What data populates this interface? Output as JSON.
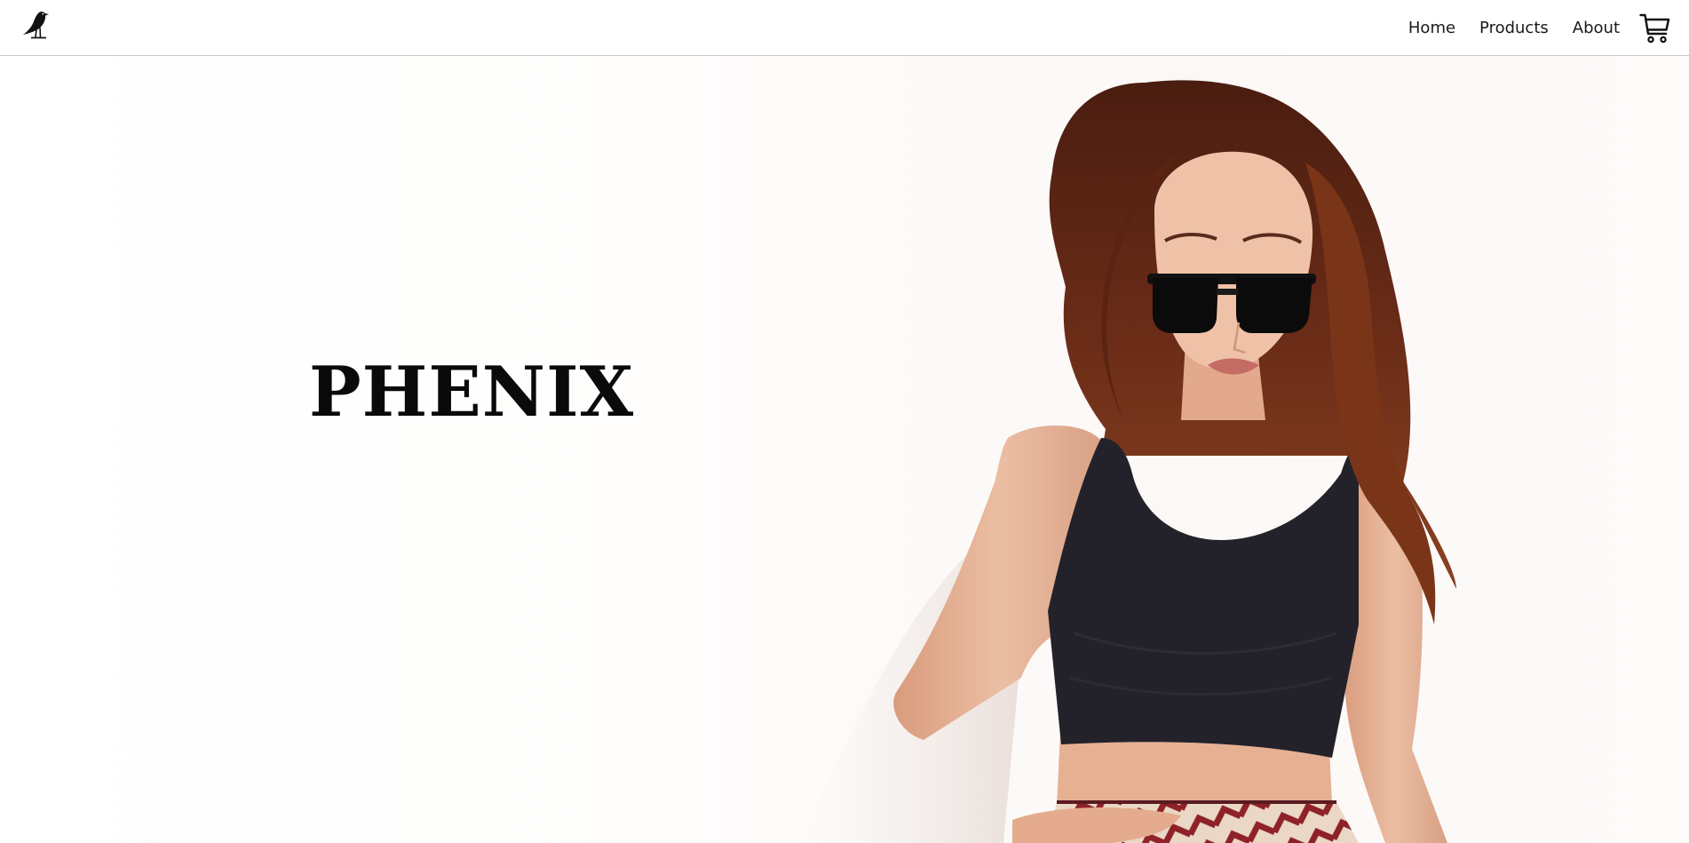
{
  "header": {
    "logo": {
      "icon": "bird-icon"
    },
    "nav": [
      {
        "label": "Home"
      },
      {
        "label": "Products"
      },
      {
        "label": "About"
      }
    ],
    "cart": {
      "icon": "cart-icon"
    }
  },
  "hero": {
    "title": "PHENIX",
    "image": {
      "subject": "model-photo"
    }
  },
  "colors": {
    "text": "#1a1a1a",
    "title": "#0a0a0a",
    "border": "#c9c9c9",
    "hair": "#5a2414",
    "top": "#23222b",
    "skin": "#e7b69a",
    "skirt_red": "#8e2228",
    "skirt_cream": "#ead7c6"
  }
}
